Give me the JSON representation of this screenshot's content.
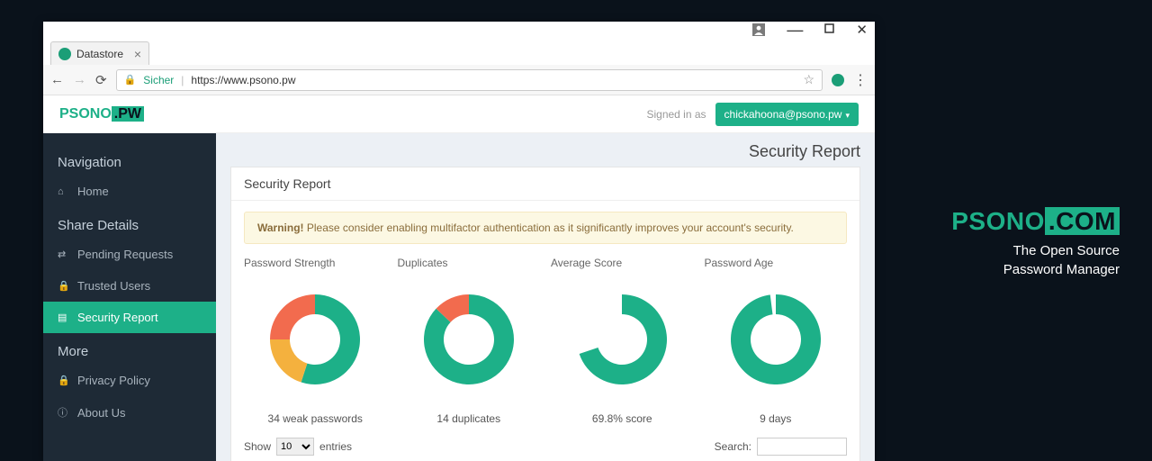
{
  "browser": {
    "tab_title": "Datastore",
    "secure_label": "Sicher",
    "url": "https://www.psono.pw"
  },
  "app": {
    "logo_prefix": "PSONO",
    "logo_suffix": ".PW",
    "signed_in_label": "Signed in as",
    "user_email": "chickahoona@psono.pw"
  },
  "sidebar": {
    "nav_heading": "Navigation",
    "items_nav": [
      {
        "label": "Home"
      }
    ],
    "share_heading": "Share Details",
    "items_share": [
      {
        "label": "Pending Requests"
      },
      {
        "label": "Trusted Users"
      },
      {
        "label": "Security Report"
      }
    ],
    "more_heading": "More",
    "items_more": [
      {
        "label": "Privacy Policy"
      },
      {
        "label": "About Us"
      }
    ]
  },
  "page": {
    "title": "Security Report",
    "panel_heading": "Security Report",
    "warning_bold": "Warning!",
    "warning_text": " Please consider enabling multifactor authentication as it significantly improves your account's security.",
    "show_label": "Show",
    "entries_value": "10",
    "entries_label": "entries",
    "search_label": "Search:"
  },
  "chart_data": [
    {
      "type": "donut",
      "title": "Password Strength",
      "series": [
        {
          "name": "strong",
          "value": 55,
          "color": "#1db088"
        },
        {
          "name": "medium",
          "value": 20,
          "color": "#f4b13e"
        },
        {
          "name": "weak",
          "value": 25,
          "color": "#f26b4e"
        }
      ],
      "caption": "34 weak passwords"
    },
    {
      "type": "donut",
      "title": "Duplicates",
      "series": [
        {
          "name": "unique",
          "value": 87,
          "color": "#1db088"
        },
        {
          "name": "duplicate",
          "value": 13,
          "color": "#f26b4e"
        }
      ],
      "caption": "14 duplicates"
    },
    {
      "type": "donut",
      "title": "Average Score",
      "series": [
        {
          "name": "score",
          "value": 69.8,
          "color": "#1db088"
        },
        {
          "name": "remaining",
          "value": 30.2,
          "color": "transparent"
        }
      ],
      "caption": "69.8% score"
    },
    {
      "type": "donut",
      "title": "Password Age",
      "series": [
        {
          "name": "age",
          "value": 98,
          "color": "#1db088"
        },
        {
          "name": "gap",
          "value": 2,
          "color": "transparent"
        }
      ],
      "caption": "9 days"
    }
  ],
  "promo": {
    "logo_prefix": "PSONO",
    "logo_suffix": ".COM",
    "tagline1": "The Open Source",
    "tagline2": "Password Manager"
  }
}
